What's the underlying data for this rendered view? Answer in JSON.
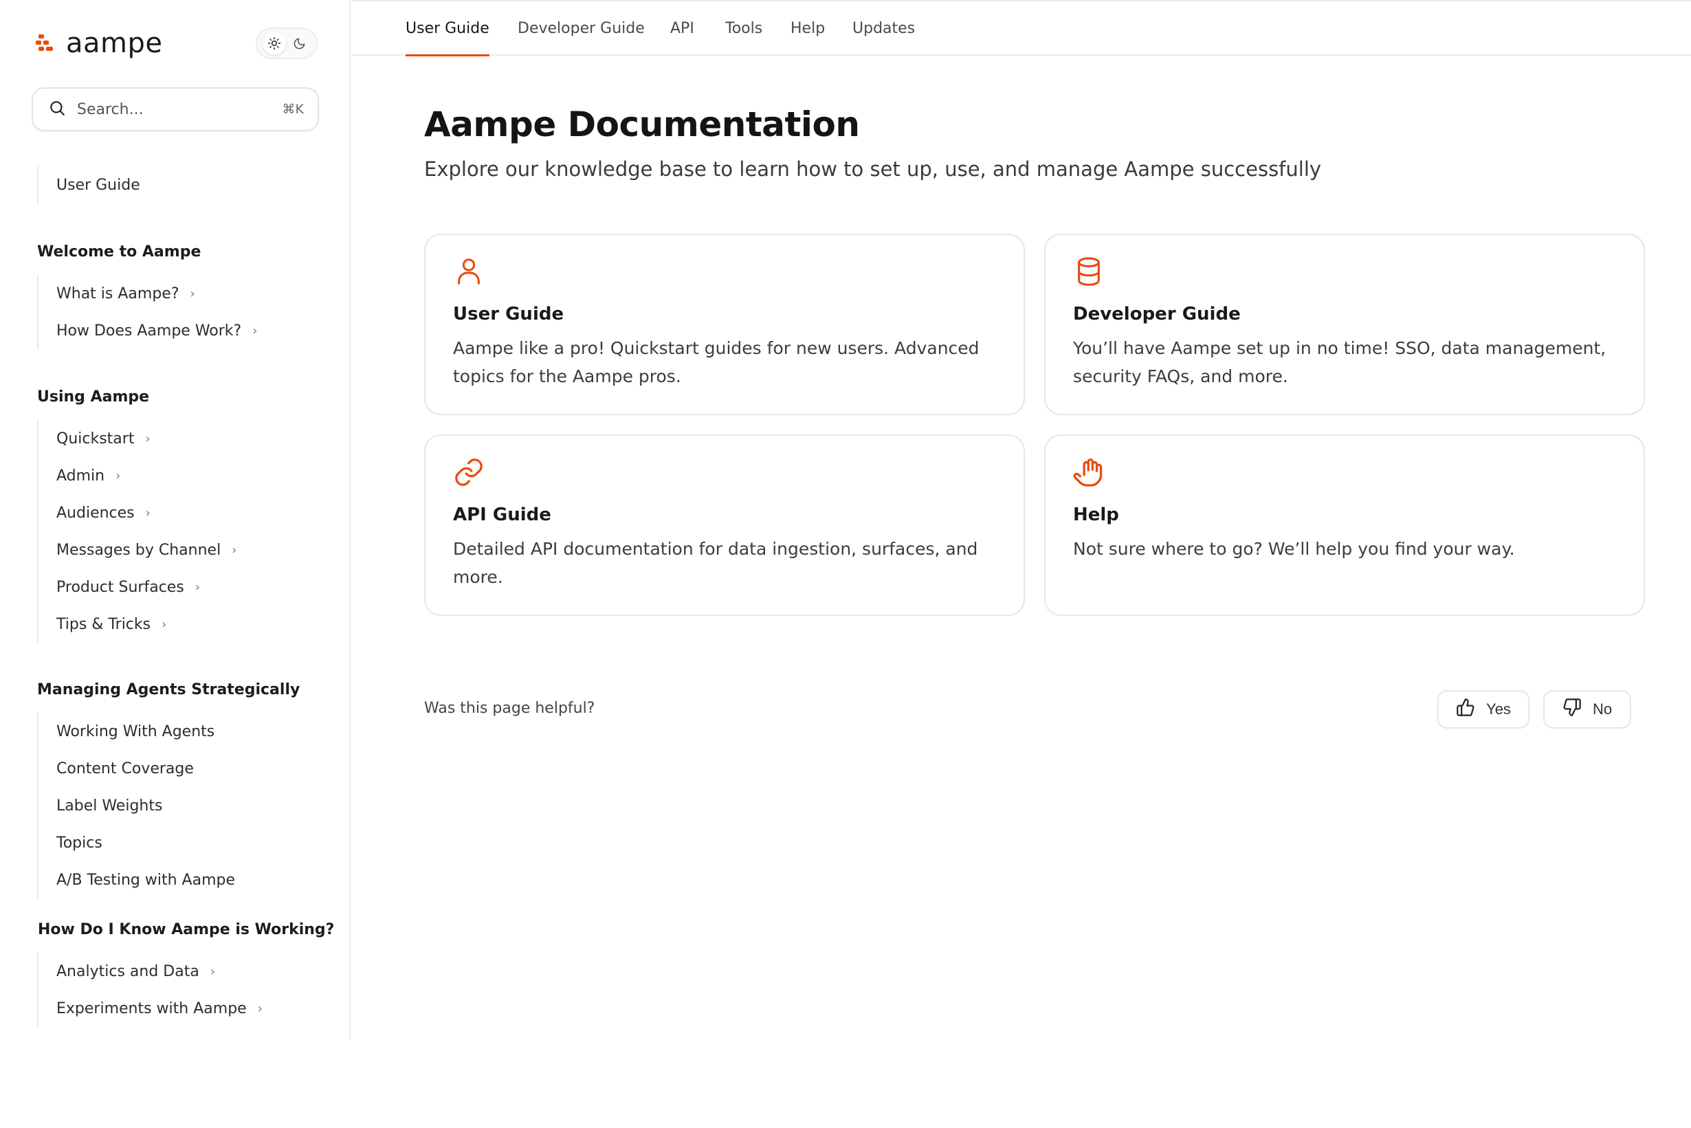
{
  "brand": {
    "name": "aampe",
    "accent_color": "#ea4a0c"
  },
  "theme_toggle": {
    "light_icon": "sun-icon",
    "dark_icon": "moon-icon",
    "active": "light"
  },
  "search": {
    "placeholder": "Search...",
    "shortcut": "⌘K",
    "icon": "search-icon"
  },
  "sidebar": {
    "top_items": [
      {
        "label": "User Guide"
      }
    ],
    "sections": [
      {
        "title": "Welcome to Aampe",
        "items": [
          {
            "label": "What is Aampe?",
            "chevron": true
          },
          {
            "label": "How Does Aampe Work?",
            "chevron": true
          }
        ]
      },
      {
        "title": "Using Aampe",
        "items": [
          {
            "label": "Quickstart",
            "chevron": true
          },
          {
            "label": "Admin",
            "chevron": true
          },
          {
            "label": "Audiences",
            "chevron": true
          },
          {
            "label": "Messages by Channel",
            "chevron": true
          },
          {
            "label": "Product Surfaces",
            "chevron": true
          },
          {
            "label": "Tips & Tricks",
            "chevron": true
          }
        ]
      },
      {
        "title": "Managing Agents Strategically",
        "items": [
          {
            "label": "Working With Agents",
            "chevron": false
          },
          {
            "label": "Content Coverage",
            "chevron": false
          },
          {
            "label": "Label Weights",
            "chevron": false
          },
          {
            "label": "Topics",
            "chevron": false
          },
          {
            "label": "A/B Testing with Aampe",
            "chevron": false
          }
        ]
      },
      {
        "title": "How Do I Know Aampe is Working?",
        "items": [
          {
            "label": "Analytics and Data",
            "chevron": true
          },
          {
            "label": "Experiments with Aampe",
            "chevron": true
          }
        ]
      }
    ],
    "chevron_glyph": "›"
  },
  "top_nav": {
    "tabs": [
      {
        "label": "User Guide",
        "active": true
      },
      {
        "label": "Developer Guide",
        "active": false
      },
      {
        "label": "API",
        "active": false
      },
      {
        "label": "Tools",
        "active": false
      },
      {
        "label": "Help",
        "active": false
      },
      {
        "label": "Updates",
        "active": false
      }
    ]
  },
  "main": {
    "title": "Aampe Documentation",
    "subtitle": "Explore our knowledge base to learn how to set up, use, and manage Aampe successfully",
    "cards": [
      {
        "icon": "user-icon",
        "title": "User Guide",
        "description": "Aampe like a pro! Quickstart guides for new users. Advanced topics for the Aampe pros."
      },
      {
        "icon": "database-icon",
        "title": "Developer Guide",
        "description": "You’ll have Aampe set up in no time! SSO, data management, security FAQs, and more."
      },
      {
        "icon": "link-icon",
        "title": "API Guide",
        "description": "Detailed API documentation for data ingestion, surfaces, and more."
      },
      {
        "icon": "hand-icon",
        "title": "Help",
        "description": "Not sure where to go? We’ll help you find your way."
      }
    ]
  },
  "feedback": {
    "question": "Was this page helpful?",
    "yes_label": "Yes",
    "no_label": "No",
    "yes_icon": "thumbs-up-icon",
    "no_icon": "thumbs-down-icon"
  }
}
